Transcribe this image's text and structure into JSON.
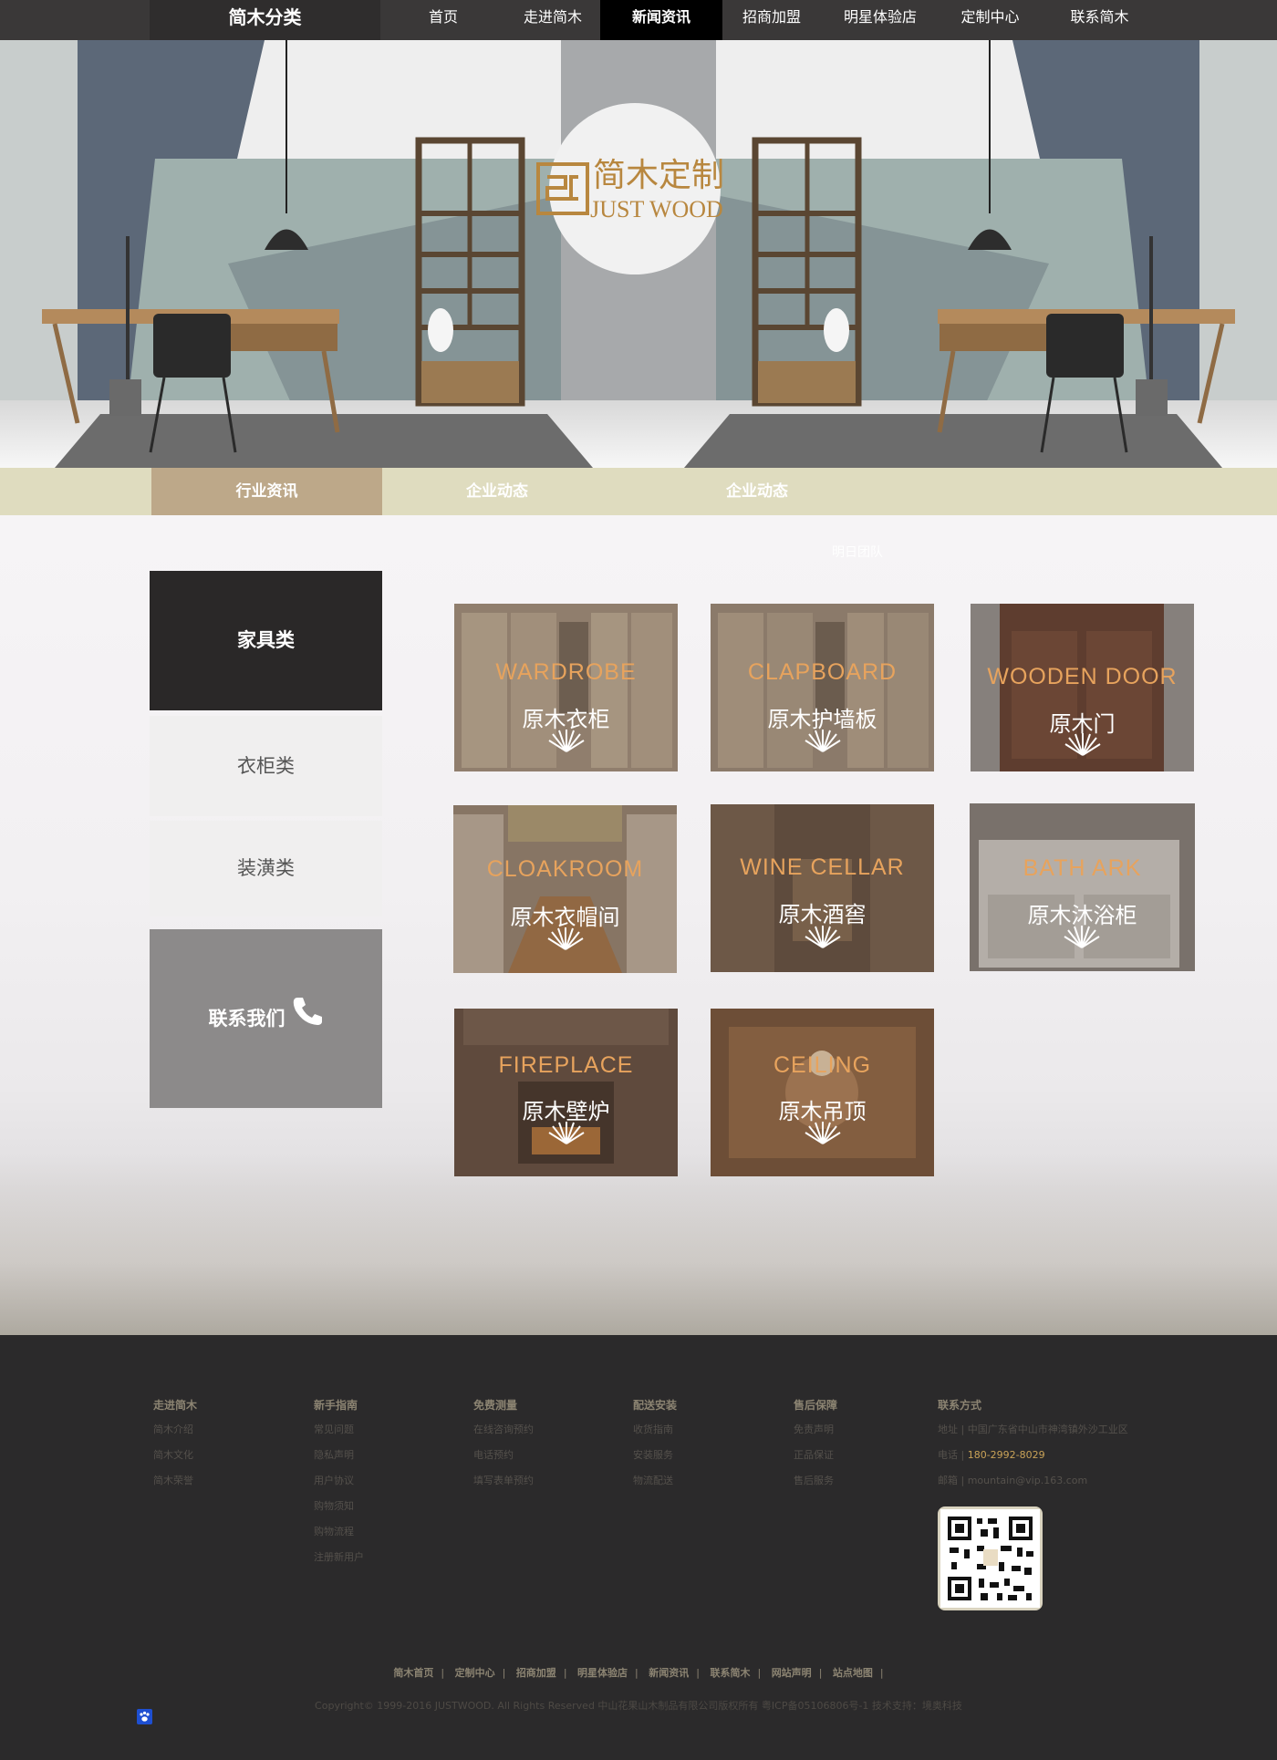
{
  "nav": {
    "brand": "简木分类",
    "items": [
      {
        "label": "首页"
      },
      {
        "label": "走进简木"
      },
      {
        "label": "新闻资讯",
        "active": true
      },
      {
        "label": "招商加盟"
      },
      {
        "label": "明星体验店"
      },
      {
        "label": "定制中心"
      },
      {
        "label": "联系简木"
      }
    ]
  },
  "hero": {
    "logo_cn": "简木定制",
    "logo_en": "JUST WOOD"
  },
  "tabs": [
    {
      "label": "行业资讯",
      "active": true
    },
    {
      "label": "企业动态"
    },
    {
      "label": "企业动态"
    }
  ],
  "main": {
    "ghost_label": "明日团队"
  },
  "sidebar": {
    "items": [
      {
        "label": "家具类"
      },
      {
        "label": "衣柜类"
      },
      {
        "label": "装潢类"
      }
    ],
    "contact": "联系我们"
  },
  "products": [
    {
      "en": "WARDROBE",
      "cn": "原木衣柜",
      "image": "wardrobe"
    },
    {
      "en": "CLAPBOARD",
      "cn": "原木护墙板",
      "image": "clapboard"
    },
    {
      "en": "WOODEN DOOR",
      "cn": "原木门",
      "image": "wooden-door"
    },
    {
      "en": "CLOAKROOM",
      "cn": "原木衣帽间",
      "image": "cloakroom"
    },
    {
      "en": "WINE CELLAR",
      "cn": "原木酒窖",
      "image": "wine-cellar"
    },
    {
      "en": "BATH ARK",
      "cn": "原木沐浴柜",
      "image": "bath-ark"
    },
    {
      "en": "FIREPLACE",
      "cn": "原木壁炉",
      "image": "fireplace"
    },
    {
      "en": "CEILING",
      "cn": "原木吊顶",
      "image": "ceiling"
    }
  ],
  "footer": {
    "columns": [
      {
        "title": "走进简木",
        "links": [
          "简木介绍",
          "简木文化",
          "简木荣誉"
        ]
      },
      {
        "title": "新手指南",
        "links": [
          "常见问题",
          "隐私声明",
          "用户协议",
          "购物须知",
          "购物流程",
          "注册新用户"
        ]
      },
      {
        "title": "免费测量",
        "links": [
          "在线咨询预约",
          "电话预约",
          "填写表单预约"
        ]
      },
      {
        "title": "配送安装",
        "links": [
          "收货指南",
          "安装服务",
          "物流配送"
        ]
      },
      {
        "title": "售后保障",
        "links": [
          "免责声明",
          "正品保证",
          "售后服务"
        ]
      }
    ],
    "contact": {
      "title": "联系方式",
      "address": "地址 | 中国广东省中山市神湾镇外沙工业区",
      "phone_label": "电话 | ",
      "phone": "180-2992-8029",
      "email": "邮箱 | mountain@vip.163.com"
    },
    "bottom_links": [
      "简木首页",
      "定制中心",
      "招商加盟",
      "明星体验店",
      "新闻资讯",
      "联系简木",
      "网站声明",
      "站点地图"
    ],
    "copyright": "Copyright© 1999-2016 JUSTWOOD. All Rights Reserved 中山花果山木制品有限公司版权所有 粤ICP备05106806号-1 技术支持：境奥科技"
  },
  "colors": {
    "nav_bg": "#3a3838",
    "tab_bar": "#dfdcbf",
    "tab_active": "#bda889",
    "accent_orange": "#e7a35d",
    "phone_highlight": "#c9a257",
    "footer_bg": "#2b2a2b"
  }
}
